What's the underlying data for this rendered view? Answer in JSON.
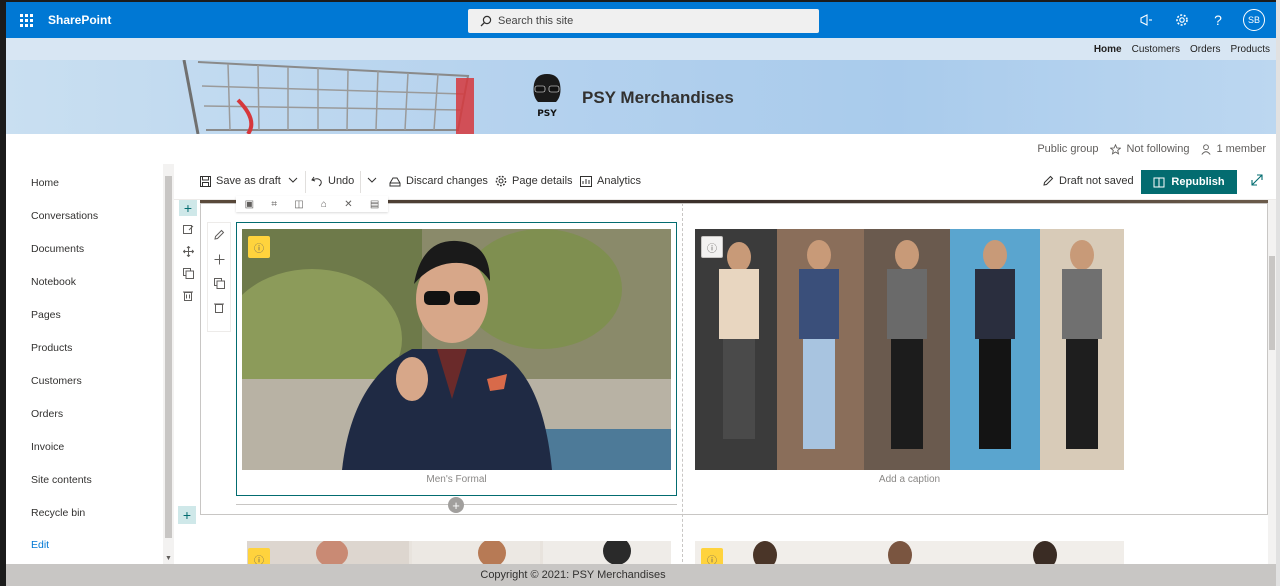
{
  "suite": {
    "app_name": "SharePoint",
    "search_placeholder": "Search this site",
    "avatar_initials": "SB",
    "icons": [
      "megaphone-icon",
      "gear-icon",
      "help-icon"
    ]
  },
  "hubnav": {
    "items": [
      {
        "label": "Home",
        "active": true
      },
      {
        "label": "Customers",
        "active": false
      },
      {
        "label": "Orders",
        "active": false
      },
      {
        "label": "Products",
        "active": false
      }
    ]
  },
  "header": {
    "site_title": "PSY Merchandises",
    "logo_text": "PSY"
  },
  "siteinfo": {
    "privacy": "Public group",
    "follow": "Not following",
    "members": "1 member"
  },
  "leftnav": {
    "items": [
      {
        "label": "Home"
      },
      {
        "label": "Conversations"
      },
      {
        "label": "Documents"
      },
      {
        "label": "Notebook"
      },
      {
        "label": "Pages"
      },
      {
        "label": "Products"
      },
      {
        "label": "Customers"
      },
      {
        "label": "Orders"
      },
      {
        "label": "Invoice"
      },
      {
        "label": "Site contents"
      },
      {
        "label": "Recycle bin"
      },
      {
        "label": "Edit"
      }
    ]
  },
  "cmdbar": {
    "save_draft": "Save as draft",
    "undo": "Undo",
    "discard": "Discard changes",
    "page_details": "Page details",
    "analytics": "Analytics",
    "draft_status": "Draft not saved",
    "republish": "Republish"
  },
  "canvas": {
    "image1_caption": "Men's Formal",
    "image2_caption": "Add a caption"
  },
  "footer": {
    "text": "Copyright © 2021: PSY Merchandises"
  },
  "colors": {
    "suite_blue": "#0078d4",
    "accent_teal": "#036c70",
    "badge_yellow": "#ffd33d"
  }
}
